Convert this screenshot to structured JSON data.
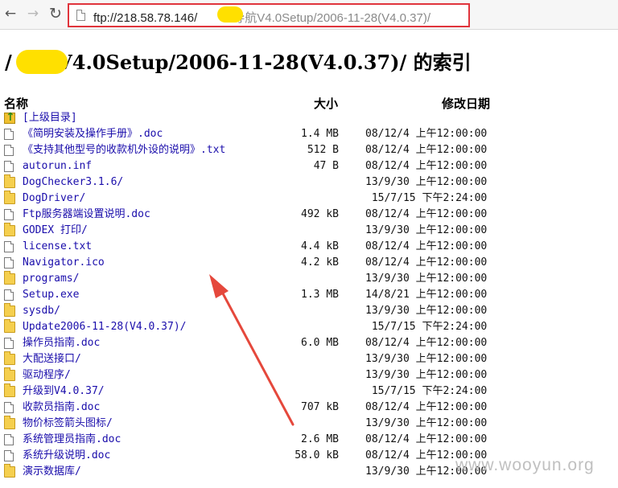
{
  "toolbar": {
    "url_host": "ftp://218.58.78.146/",
    "url_path": "导航V4.0Setup/2006-11-28(V4.0.37)/"
  },
  "page": {
    "title": "/        导航V4.0Setup/2006-11-28(V4.0.37)/ 的索引"
  },
  "columns": {
    "name": "名称",
    "size": "大小",
    "date": "修改日期"
  },
  "entries": [
    {
      "name": "[上级目录]",
      "size": "",
      "date": "",
      "icon": "parent-icon"
    },
    {
      "name": "《简明安装及操作手册》.doc",
      "size": "1.4 MB",
      "date": "08/12/4 上午12:00:00",
      "icon": "file-icon"
    },
    {
      "name": "《支持其他型号的收款机外设的说明》.txt",
      "size": "512 B",
      "date": "08/12/4 上午12:00:00",
      "icon": "file-icon"
    },
    {
      "name": "autorun.inf",
      "size": "47 B",
      "date": "08/12/4 上午12:00:00",
      "icon": "file-icon"
    },
    {
      "name": "DogChecker3.1.6/",
      "size": "",
      "date": "13/9/30 上午12:00:00",
      "icon": "folder-icon"
    },
    {
      "name": "DogDriver/",
      "size": "",
      "date": " 15/7/15 下午2:24:00",
      "icon": "folder-icon"
    },
    {
      "name": "Ftp服务器端设置说明.doc",
      "size": "492 kB",
      "date": "08/12/4 上午12:00:00",
      "icon": "file-icon"
    },
    {
      "name": "GODEX 打印/",
      "size": "",
      "date": "13/9/30 上午12:00:00",
      "icon": "folder-icon"
    },
    {
      "name": "license.txt",
      "size": "4.4 kB",
      "date": "08/12/4 上午12:00:00",
      "icon": "file-icon"
    },
    {
      "name": "Navigator.ico",
      "size": "4.2 kB",
      "date": "08/12/4 上午12:00:00",
      "icon": "file-icon"
    },
    {
      "name": "programs/",
      "size": "",
      "date": "13/9/30 上午12:00:00",
      "icon": "folder-icon"
    },
    {
      "name": "Setup.exe",
      "size": "1.3 MB",
      "date": "14/8/21 上午12:00:00",
      "icon": "file-icon"
    },
    {
      "name": "sysdb/",
      "size": "",
      "date": "13/9/30 上午12:00:00",
      "icon": "folder-icon"
    },
    {
      "name": "Update2006-11-28(V4.0.37)/",
      "size": "",
      "date": " 15/7/15 下午2:24:00",
      "icon": "folder-icon"
    },
    {
      "name": "操作员指南.doc",
      "size": "6.0 MB",
      "date": "08/12/4 上午12:00:00",
      "icon": "file-icon"
    },
    {
      "name": "大配送接口/",
      "size": "",
      "date": "13/9/30 上午12:00:00",
      "icon": "folder-icon"
    },
    {
      "name": "驱动程序/",
      "size": "",
      "date": "13/9/30 上午12:00:00",
      "icon": "folder-icon"
    },
    {
      "name": "升级到V4.0.37/",
      "size": "",
      "date": " 15/7/15 下午2:24:00",
      "icon": "folder-icon"
    },
    {
      "name": "收款员指南.doc",
      "size": "707 kB",
      "date": "08/12/4 上午12:00:00",
      "icon": "file-icon"
    },
    {
      "name": "物价标签箭头图标/",
      "size": "",
      "date": "13/9/30 上午12:00:00",
      "icon": "folder-icon"
    },
    {
      "name": "系统管理员指南.doc",
      "size": "2.6 MB",
      "date": "08/12/4 上午12:00:00",
      "icon": "file-icon"
    },
    {
      "name": "系统升级说明.doc",
      "size": "58.0 kB",
      "date": "08/12/4 上午12:00:00",
      "icon": "file-icon"
    },
    {
      "name": "演示数据库/",
      "size": "",
      "date": "13/9/30 上午12:00:00",
      "icon": "folder-icon"
    }
  ],
  "watermark": "www.wooyun.org",
  "colors": {
    "highlight_border": "#e0343c",
    "redaction": "#ffe000",
    "link": "#1a0dab"
  }
}
